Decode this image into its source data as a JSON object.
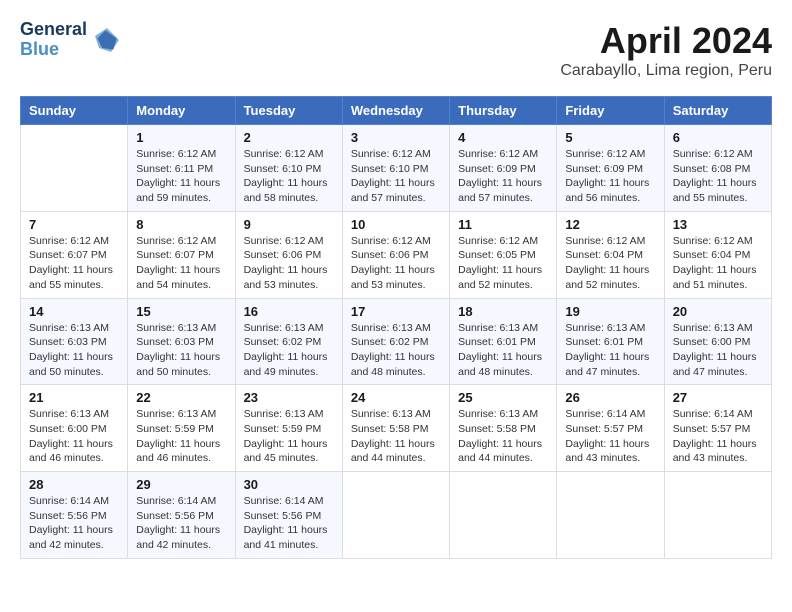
{
  "header": {
    "logo_line1": "General",
    "logo_line2": "Blue",
    "month_title": "April 2024",
    "location": "Carabayllo, Lima region, Peru"
  },
  "weekdays": [
    "Sunday",
    "Monday",
    "Tuesday",
    "Wednesday",
    "Thursday",
    "Friday",
    "Saturday"
  ],
  "weeks": [
    [
      {
        "day": "",
        "info": ""
      },
      {
        "day": "1",
        "info": "Sunrise: 6:12 AM\nSunset: 6:11 PM\nDaylight: 11 hours\nand 59 minutes."
      },
      {
        "day": "2",
        "info": "Sunrise: 6:12 AM\nSunset: 6:10 PM\nDaylight: 11 hours\nand 58 minutes."
      },
      {
        "day": "3",
        "info": "Sunrise: 6:12 AM\nSunset: 6:10 PM\nDaylight: 11 hours\nand 57 minutes."
      },
      {
        "day": "4",
        "info": "Sunrise: 6:12 AM\nSunset: 6:09 PM\nDaylight: 11 hours\nand 57 minutes."
      },
      {
        "day": "5",
        "info": "Sunrise: 6:12 AM\nSunset: 6:09 PM\nDaylight: 11 hours\nand 56 minutes."
      },
      {
        "day": "6",
        "info": "Sunrise: 6:12 AM\nSunset: 6:08 PM\nDaylight: 11 hours\nand 55 minutes."
      }
    ],
    [
      {
        "day": "7",
        "info": "Sunrise: 6:12 AM\nSunset: 6:07 PM\nDaylight: 11 hours\nand 55 minutes."
      },
      {
        "day": "8",
        "info": "Sunrise: 6:12 AM\nSunset: 6:07 PM\nDaylight: 11 hours\nand 54 minutes."
      },
      {
        "day": "9",
        "info": "Sunrise: 6:12 AM\nSunset: 6:06 PM\nDaylight: 11 hours\nand 53 minutes."
      },
      {
        "day": "10",
        "info": "Sunrise: 6:12 AM\nSunset: 6:06 PM\nDaylight: 11 hours\nand 53 minutes."
      },
      {
        "day": "11",
        "info": "Sunrise: 6:12 AM\nSunset: 6:05 PM\nDaylight: 11 hours\nand 52 minutes."
      },
      {
        "day": "12",
        "info": "Sunrise: 6:12 AM\nSunset: 6:04 PM\nDaylight: 11 hours\nand 52 minutes."
      },
      {
        "day": "13",
        "info": "Sunrise: 6:12 AM\nSunset: 6:04 PM\nDaylight: 11 hours\nand 51 minutes."
      }
    ],
    [
      {
        "day": "14",
        "info": "Sunrise: 6:13 AM\nSunset: 6:03 PM\nDaylight: 11 hours\nand 50 minutes."
      },
      {
        "day": "15",
        "info": "Sunrise: 6:13 AM\nSunset: 6:03 PM\nDaylight: 11 hours\nand 50 minutes."
      },
      {
        "day": "16",
        "info": "Sunrise: 6:13 AM\nSunset: 6:02 PM\nDaylight: 11 hours\nand 49 minutes."
      },
      {
        "day": "17",
        "info": "Sunrise: 6:13 AM\nSunset: 6:02 PM\nDaylight: 11 hours\nand 48 minutes."
      },
      {
        "day": "18",
        "info": "Sunrise: 6:13 AM\nSunset: 6:01 PM\nDaylight: 11 hours\nand 48 minutes."
      },
      {
        "day": "19",
        "info": "Sunrise: 6:13 AM\nSunset: 6:01 PM\nDaylight: 11 hours\nand 47 minutes."
      },
      {
        "day": "20",
        "info": "Sunrise: 6:13 AM\nSunset: 6:00 PM\nDaylight: 11 hours\nand 47 minutes."
      }
    ],
    [
      {
        "day": "21",
        "info": "Sunrise: 6:13 AM\nSunset: 6:00 PM\nDaylight: 11 hours\nand 46 minutes."
      },
      {
        "day": "22",
        "info": "Sunrise: 6:13 AM\nSunset: 5:59 PM\nDaylight: 11 hours\nand 46 minutes."
      },
      {
        "day": "23",
        "info": "Sunrise: 6:13 AM\nSunset: 5:59 PM\nDaylight: 11 hours\nand 45 minutes."
      },
      {
        "day": "24",
        "info": "Sunrise: 6:13 AM\nSunset: 5:58 PM\nDaylight: 11 hours\nand 44 minutes."
      },
      {
        "day": "25",
        "info": "Sunrise: 6:13 AM\nSunset: 5:58 PM\nDaylight: 11 hours\nand 44 minutes."
      },
      {
        "day": "26",
        "info": "Sunrise: 6:14 AM\nSunset: 5:57 PM\nDaylight: 11 hours\nand 43 minutes."
      },
      {
        "day": "27",
        "info": "Sunrise: 6:14 AM\nSunset: 5:57 PM\nDaylight: 11 hours\nand 43 minutes."
      }
    ],
    [
      {
        "day": "28",
        "info": "Sunrise: 6:14 AM\nSunset: 5:56 PM\nDaylight: 11 hours\nand 42 minutes."
      },
      {
        "day": "29",
        "info": "Sunrise: 6:14 AM\nSunset: 5:56 PM\nDaylight: 11 hours\nand 42 minutes."
      },
      {
        "day": "30",
        "info": "Sunrise: 6:14 AM\nSunset: 5:56 PM\nDaylight: 11 hours\nand 41 minutes."
      },
      {
        "day": "",
        "info": ""
      },
      {
        "day": "",
        "info": ""
      },
      {
        "day": "",
        "info": ""
      },
      {
        "day": "",
        "info": ""
      }
    ]
  ]
}
